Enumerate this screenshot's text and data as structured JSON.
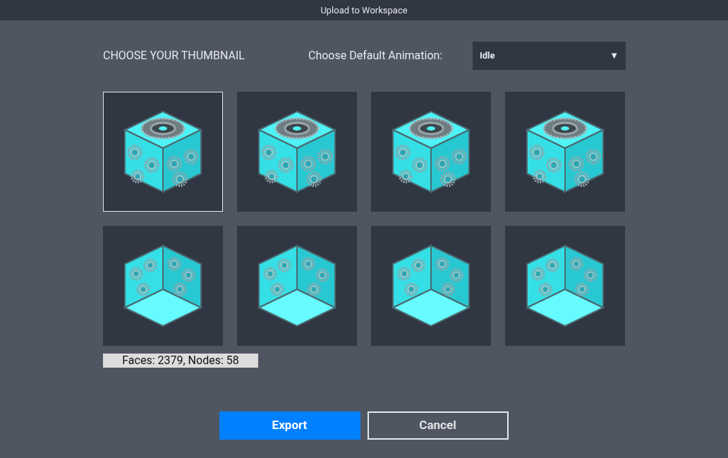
{
  "window": {
    "title": "Upload to Workspace"
  },
  "thumbnail_heading": "CHOOSE YOUR THUMBNAIL",
  "animation": {
    "label": "Choose Default Animation:",
    "value": "Idle",
    "caret": "▼"
  },
  "thumbnails": [
    {
      "kind": "top",
      "selected": true
    },
    {
      "kind": "top",
      "selected": false
    },
    {
      "kind": "top",
      "selected": false
    },
    {
      "kind": "top",
      "selected": false
    },
    {
      "kind": "bottom",
      "selected": false
    },
    {
      "kind": "bottom",
      "selected": false
    },
    {
      "kind": "bottom",
      "selected": false
    },
    {
      "kind": "bottom",
      "selected": false
    }
  ],
  "stats": "Faces: 2379, Nodes: 58",
  "buttons": [
    {
      "label": "Export",
      "kind": "primary"
    },
    {
      "label": "Cancel",
      "kind": "secondary"
    }
  ]
}
